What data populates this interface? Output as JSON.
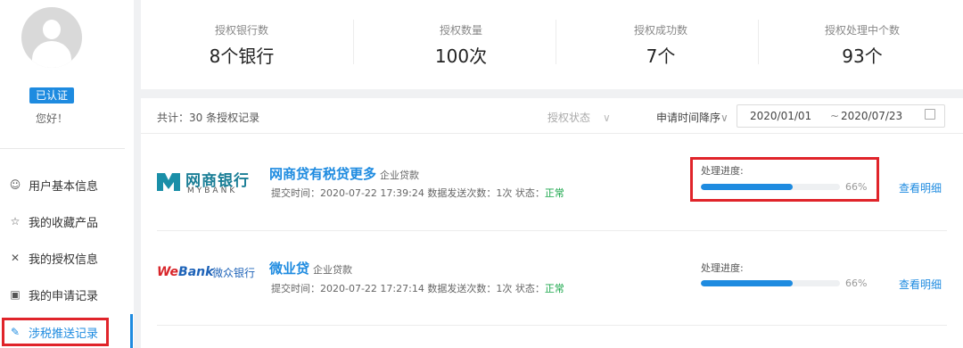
{
  "sidebar": {
    "verified_badge": "已认证",
    "greeting": "您好！",
    "items": [
      {
        "label": "用户基本信息",
        "icon": "user-icon"
      },
      {
        "label": "我的收藏产品",
        "icon": "star-icon"
      },
      {
        "label": "我的授权信息",
        "icon": "authorize-icon"
      },
      {
        "label": "我的申请记录",
        "icon": "record-icon"
      },
      {
        "label": "涉税推送记录",
        "icon": "edit-icon",
        "active": true
      }
    ],
    "accent_color": "#1e8be0",
    "highlight_color": "#e0242a"
  },
  "stats": [
    {
      "label": "授权银行数",
      "value": "8个银行"
    },
    {
      "label": "授权数量",
      "value": "100次"
    },
    {
      "label": "授权成功数",
      "value": "7个"
    },
    {
      "label": "授权处理中个数",
      "value": "93个"
    }
  ],
  "filter": {
    "total": "共计：30 条授权记录",
    "status_filter": "授权状态",
    "sort": "申请时间降序",
    "date_from": "2020/01/01",
    "date_sep": "~",
    "date_to": "2020/07/23"
  },
  "records": [
    {
      "bank_logo_cn": "网商银行",
      "bank_logo_en": "MYBANK",
      "title": "网商贷有税贷更多",
      "type": "企业贷款",
      "meta_prefix": "提交时间：2020-07-22 17:39:24 数据发送次数：1次 状态：",
      "status": "正常",
      "progress_label": "处理进度:",
      "progress_value": 0.66,
      "progress_text": "66%",
      "detail_link": "查看明细"
    },
    {
      "bank_logo_we": "We",
      "bank_logo_bank": "Bank",
      "bank_logo_cn": "微众银行",
      "title": "微业贷",
      "type": "企业贷款",
      "meta_prefix": "提交时间：2020-07-22 17:27:14 数据发送次数：1次 状态：",
      "status": "正常",
      "progress_label": "处理进度:",
      "progress_value": 0.66,
      "progress_text": "66%",
      "detail_link": "查看明细"
    }
  ]
}
